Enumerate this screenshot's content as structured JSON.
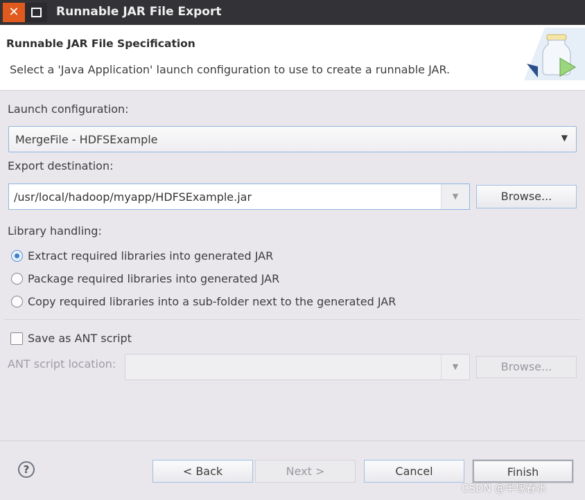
{
  "window": {
    "title": "Runnable JAR File Export"
  },
  "header": {
    "title": "Runnable JAR File Specification",
    "description": "Select a 'Java Application' launch configuration to use to create a runnable JAR."
  },
  "launch": {
    "label": "Launch configuration:",
    "value": "MergeFile - HDFSExample"
  },
  "export": {
    "label": "Export destination:",
    "value": "/usr/local/hadoop/myapp/HDFSExample.jar",
    "browse": "Browse..."
  },
  "library": {
    "label": "Library handling:",
    "options": [
      {
        "label": "Extract required libraries into generated JAR",
        "selected": true
      },
      {
        "label": "Package required libraries into generated JAR",
        "selected": false
      },
      {
        "label": "Copy required libraries into a sub-folder next to the generated JAR",
        "selected": false
      }
    ]
  },
  "ant": {
    "checkbox": "Save as ANT script",
    "checked": false,
    "location_label": "ANT script location:",
    "location_value": "",
    "browse": "Browse..."
  },
  "footer": {
    "back": "< Back",
    "next": "Next >",
    "cancel": "Cancel",
    "finish": "Finish"
  },
  "watermark": "CSDN @半塚春水"
}
